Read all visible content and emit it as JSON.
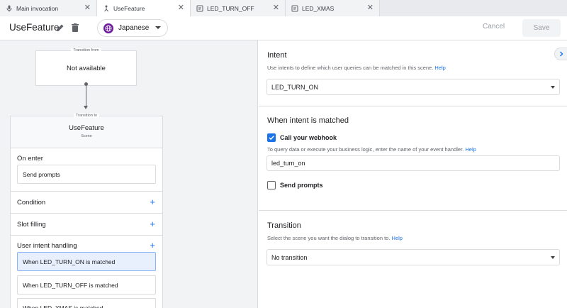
{
  "tabs": [
    {
      "label": "Main invocation",
      "icon": "microphone-icon",
      "active": false
    },
    {
      "label": "UseFeature",
      "icon": "scene-icon",
      "active": true
    },
    {
      "label": "LED_TURN_OFF",
      "icon": "intent-icon",
      "active": false
    },
    {
      "label": "LED_XMAS",
      "icon": "intent-icon",
      "active": false
    }
  ],
  "header": {
    "title": "UseFeature",
    "language": "Japanese",
    "cancel_label": "Cancel",
    "save_label": "Save"
  },
  "canvas": {
    "transition_from": {
      "caption": "Transition from",
      "value": "Not available"
    },
    "transition_to": {
      "caption": "Transition to",
      "name": "UseFeature",
      "type": "Scene"
    },
    "on_enter": {
      "label": "On enter",
      "item": "Send prompts"
    },
    "condition": {
      "label": "Condition"
    },
    "slot_filling": {
      "label": "Slot filling"
    },
    "user_intent_handling": {
      "label": "User intent handling",
      "items": [
        "When LED_TURN_ON is matched",
        "When LED_TURN_OFF is matched",
        "When LED_XMAS is matched"
      ]
    }
  },
  "panel": {
    "intent": {
      "title": "Intent",
      "description": "Use intents to define which user queries can be matched in this scene.",
      "help": "Help",
      "selected": "LED_TURN_ON"
    },
    "when_matched": {
      "title": "When intent is matched",
      "webhook_label": "Call your webhook",
      "webhook_checked": true,
      "webhook_desc": "To query data or execute your business logic, enter the name of your event handler.",
      "help": "Help",
      "handler": "led_turn_on",
      "prompts_label": "Send prompts",
      "prompts_checked": false
    },
    "transition": {
      "title": "Transition",
      "description": "Select the scene you want the dialog to transition to.",
      "help": "Help",
      "selected": "No transition"
    }
  },
  "colors": {
    "accent": "#1a73e8",
    "language_badge": "#6a1b9a"
  }
}
